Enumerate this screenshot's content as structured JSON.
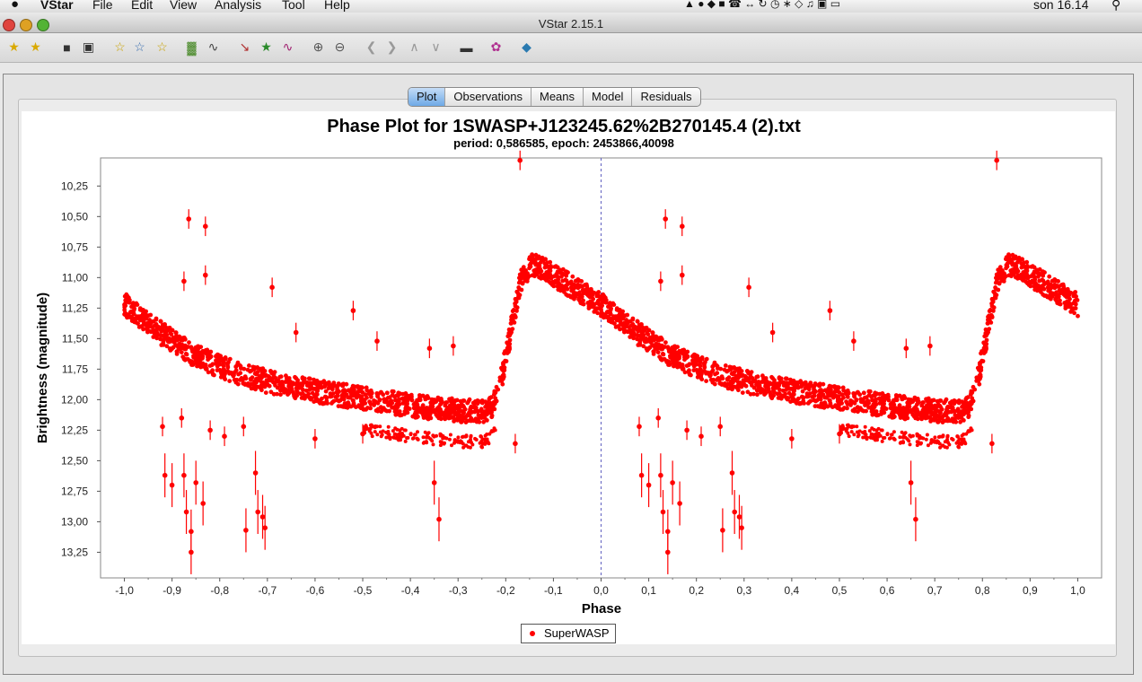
{
  "menubar": {
    "apple_icon": "",
    "app_name": "VStar",
    "items": [
      "File",
      "Edit",
      "View",
      "Analysis",
      "Tool",
      "Help"
    ],
    "clock": "son 16.14"
  },
  "window": {
    "title": "VStar 2.15.1"
  },
  "toolbar": {
    "icons": [
      "new-star-icon",
      "open-star-icon",
      "save-icon",
      "print-icon",
      "star-info-icon",
      "star-observations-icon",
      "star-filter-icon",
      "mean-bars-icon",
      "wave-icon",
      "zoom-plot-icon",
      "star-model-icon",
      "polynomial-fit-icon",
      "zoom-in-icon",
      "zoom-out-icon",
      "pan-left-icon",
      "pan-right-icon",
      "pan-up-icon",
      "pan-down-icon",
      "telescope-icon",
      "plugin-icon",
      "info-icon"
    ]
  },
  "tabs": [
    "Plot",
    "Observations",
    "Means",
    "Model",
    "Residuals"
  ],
  "active_tab": "Plot",
  "colors": {
    "series": "#ff0000",
    "active_tab": "#6ea9e6"
  },
  "chart_data": {
    "type": "scatter",
    "title": "Phase Plot for 1SWASP+J123245.62%2B270145.4 (2).txt",
    "subtitle": "period: 0,586585, epoch: 2453866,40098",
    "xlabel": "Phase",
    "ylabel": "Brightness (magnitude)",
    "xlim": [
      -1.05,
      1.05
    ],
    "ylim": [
      10.02,
      13.46
    ],
    "y_inverted": true,
    "x_ticks": [
      "-1,0",
      "-0,9",
      "-0,8",
      "-0,7",
      "-0,6",
      "-0,5",
      "-0,4",
      "-0,3",
      "-0,2",
      "-0,1",
      "0,0",
      "0,1",
      "0,2",
      "0,3",
      "0,4",
      "0,5",
      "0,6",
      "0,7",
      "0,8",
      "0,9",
      "1,0"
    ],
    "x_tick_values": [
      -1.0,
      -0.9,
      -0.8,
      -0.7,
      -0.6,
      -0.5,
      -0.4,
      -0.3,
      -0.2,
      -0.1,
      0.0,
      0.1,
      0.2,
      0.3,
      0.4,
      0.5,
      0.6,
      0.7,
      0.8,
      0.9,
      1.0
    ],
    "y_ticks": [
      "10,25",
      "10,50",
      "10,75",
      "11,00",
      "11,25",
      "11,50",
      "11,75",
      "12,00",
      "12,25",
      "12,50",
      "12,75",
      "13,00",
      "13,25"
    ],
    "y_tick_values": [
      10.25,
      10.5,
      10.75,
      11.0,
      11.25,
      11.5,
      11.75,
      12.0,
      12.25,
      12.5,
      12.75,
      13.0,
      13.25
    ],
    "vertical_reference": 0.0,
    "legend": [
      "SuperWASP"
    ],
    "legend_position": "bottom-center",
    "series": [
      {
        "name": "SuperWASP",
        "curve": [
          [
            0.0,
            11.22
          ],
          [
            0.05,
            11.38
          ],
          [
            0.1,
            11.52
          ],
          [
            0.15,
            11.64
          ],
          [
            0.2,
            11.73
          ],
          [
            0.25,
            11.8
          ],
          [
            0.3,
            11.85
          ],
          [
            0.35,
            11.89
          ],
          [
            0.4,
            11.93
          ],
          [
            0.45,
            11.96
          ],
          [
            0.5,
            11.99
          ],
          [
            0.55,
            12.02
          ],
          [
            0.6,
            12.05
          ],
          [
            0.65,
            12.07
          ],
          [
            0.7,
            12.09
          ],
          [
            0.75,
            12.1
          ],
          [
            0.77,
            12.06
          ],
          [
            0.79,
            11.85
          ],
          [
            0.81,
            11.45
          ],
          [
            0.83,
            11.05
          ],
          [
            0.85,
            10.9
          ],
          [
            0.875,
            10.92
          ],
          [
            0.9,
            10.98
          ],
          [
            0.95,
            11.1
          ],
          [
            1.0,
            11.22
          ]
        ],
        "curve_spread": 0.12,
        "outliers": [
          [
            -0.915,
            12.62
          ],
          [
            -0.9,
            12.7
          ],
          [
            -0.875,
            12.62
          ],
          [
            -0.87,
            12.92
          ],
          [
            -0.86,
            13.08
          ],
          [
            -0.86,
            13.25
          ],
          [
            -0.85,
            12.68
          ],
          [
            -0.835,
            12.85
          ],
          [
            -0.79,
            12.3
          ],
          [
            -0.745,
            13.07
          ],
          [
            -0.72,
            12.92
          ],
          [
            -0.71,
            12.96
          ],
          [
            -0.705,
            13.05
          ],
          [
            -0.725,
            12.6
          ],
          [
            -0.35,
            12.68
          ],
          [
            -0.34,
            12.98
          ],
          [
            -0.18,
            12.36
          ],
          [
            -0.17,
            10.04
          ],
          [
            -0.865,
            10.52
          ],
          [
            -0.83,
            10.58
          ],
          [
            -0.875,
            11.03
          ],
          [
            -0.83,
            10.98
          ],
          [
            -0.31,
            11.56
          ],
          [
            -0.36,
            11.58
          ],
          [
            -0.47,
            11.52
          ],
          [
            -0.52,
            11.27
          ],
          [
            -0.64,
            11.45
          ],
          [
            -0.69,
            11.08
          ],
          [
            -0.92,
            12.22
          ],
          [
            -0.82,
            12.25
          ],
          [
            -0.88,
            12.15
          ],
          [
            -0.75,
            12.22
          ],
          [
            -0.6,
            12.32
          ],
          [
            -0.5,
            12.28
          ]
        ]
      }
    ]
  },
  "legend_label": "SuperWASP"
}
